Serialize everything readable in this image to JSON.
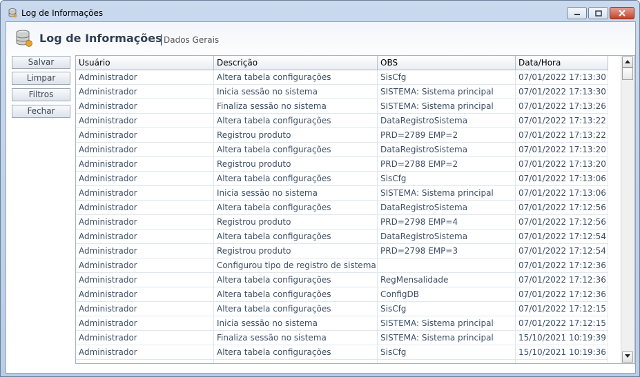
{
  "window": {
    "title": "Log de Informações"
  },
  "header": {
    "title": "Log de Informações",
    "separator": "|",
    "subtitle": "Dados Gerais"
  },
  "sidebar": {
    "buttons": [
      {
        "label": "Salvar"
      },
      {
        "label": "Limpar"
      },
      {
        "label": "Filtros"
      },
      {
        "label": "Fechar"
      }
    ]
  },
  "table": {
    "columns": [
      "Usuário",
      "Descrição",
      "OBS",
      "Data/Hora"
    ],
    "rows": [
      [
        "Administrador",
        "Altera tabela configurações",
        "SisCfg",
        "07/01/2022 17:13:30"
      ],
      [
        "Administrador",
        "Inicia sessão no sistema",
        "SISTEMA: Sistema principal",
        "07/01/2022 17:13:30"
      ],
      [
        "Administrador",
        "Finaliza sessão no sistema",
        "SISTEMA: Sistema principal",
        "07/01/2022 17:13:26"
      ],
      [
        "Administrador",
        "Altera tabela configurações",
        "DataRegistroSistema",
        "07/01/2022 17:13:22"
      ],
      [
        "Administrador",
        "Registrou produto",
        "PRD=2789 EMP=2",
        "07/01/2022 17:13:22"
      ],
      [
        "Administrador",
        "Altera tabela configurações",
        "DataRegistroSistema",
        "07/01/2022 17:13:20"
      ],
      [
        "Administrador",
        "Registrou produto",
        "PRD=2788 EMP=2",
        "07/01/2022 17:13:20"
      ],
      [
        "Administrador",
        "Altera tabela configurações",
        "SisCfg",
        "07/01/2022 17:13:06"
      ],
      [
        "Administrador",
        "Inicia sessão no sistema",
        "SISTEMA: Sistema principal",
        "07/01/2022 17:13:06"
      ],
      [
        "Administrador",
        "Altera tabela configurações",
        "DataRegistroSistema",
        "07/01/2022 17:12:56"
      ],
      [
        "Administrador",
        "Registrou produto",
        "PRD=2798 EMP=4",
        "07/01/2022 17:12:56"
      ],
      [
        "Administrador",
        "Altera tabela configurações",
        "DataRegistroSistema",
        "07/01/2022 17:12:54"
      ],
      [
        "Administrador",
        "Registrou produto",
        "PRD=2798 EMP=3",
        "07/01/2022 17:12:54"
      ],
      [
        "Administrador",
        "Configurou tipo de registro de sistema",
        "",
        "07/01/2022 17:12:36"
      ],
      [
        "Administrador",
        "Altera tabela configurações",
        "RegMensalidade",
        "07/01/2022 17:12:36"
      ],
      [
        "Administrador",
        "Altera tabela configurações",
        "ConfigDB",
        "07/01/2022 17:12:36"
      ],
      [
        "Administrador",
        "Altera tabela configurações",
        "SisCfg",
        "07/01/2022 17:12:15"
      ],
      [
        "Administrador",
        "Inicia sessão no sistema",
        "SISTEMA: Sistema principal",
        "07/01/2022 17:12:15"
      ],
      [
        "Administrador",
        "Finaliza sessão no sistema",
        "SISTEMA: Sistema principal",
        "15/10/2021 10:19:39"
      ],
      [
        "Administrador",
        "Altera tabela configurações",
        "SisCfg",
        "15/10/2021 10:19:36"
      ]
    ]
  },
  "icons": {
    "app": "database-icon",
    "header": "database-icon",
    "minimize": "minimize-icon",
    "maximize": "maximize-icon",
    "close": "close-icon",
    "scroll_up": "arrow-up-icon",
    "scroll_down": "arrow-down-icon"
  }
}
